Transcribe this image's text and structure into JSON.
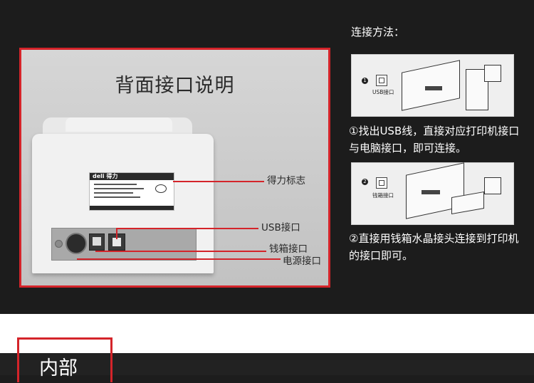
{
  "panel": {
    "title": "背面接口说明",
    "label_brand": "deli 得力",
    "callouts": {
      "brand_mark": "得力标志",
      "usb_port": "USB接口",
      "cash_drawer_port": "钱箱接口",
      "power_port": "电源接口"
    }
  },
  "method": {
    "title": "连接方法：",
    "step1": {
      "number": "1",
      "port_label": "USB接口",
      "description": "①找出USB线，直接对应打印机接口与电脑接口，即可连接。"
    },
    "step2": {
      "number": "2",
      "port_label": "钱箱接口",
      "description": "②直接用钱箱水晶接头连接到打印机的接口即可。"
    }
  },
  "section": {
    "title": "内部"
  },
  "colors": {
    "accent": "#d4242a",
    "background": "#1c1c1c"
  }
}
